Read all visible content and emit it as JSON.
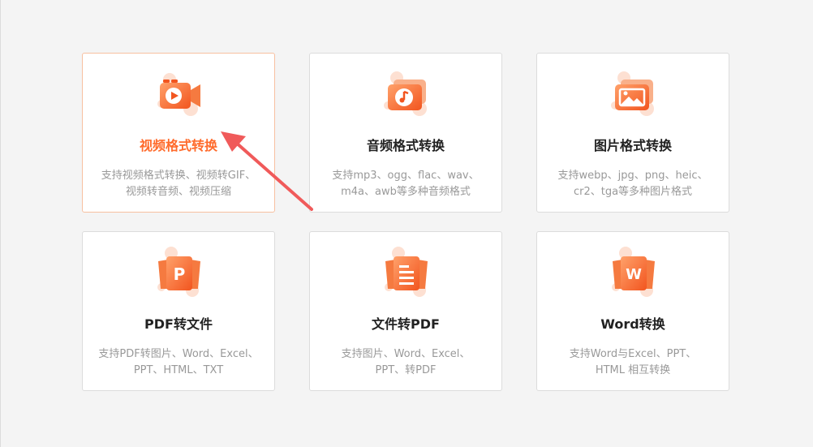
{
  "accent_color": "#ff6b2c",
  "annotation_color": "#f05a5a",
  "cards": [
    {
      "icon": "video-icon",
      "title": "视频格式转换",
      "desc_line1": "支持视频格式转换、视频转GIF、",
      "desc_line2": "视频转音频、视频压缩",
      "active": true
    },
    {
      "icon": "audio-icon",
      "title": "音频格式转换",
      "desc_line1": "支持mp3、ogg、flac、wav、",
      "desc_line2": "m4a、awb等多种音频格式",
      "active": false
    },
    {
      "icon": "image-icon",
      "title": "图片格式转换",
      "desc_line1": "支持webp、jpg、png、heic、",
      "desc_line2": "cr2、tga等多种图片格式",
      "active": false
    },
    {
      "icon": "pdf-icon",
      "title": "PDF转文件",
      "desc_line1": "支持PDF转图片、Word、Excel、",
      "desc_line2": "PPT、HTML、TXT",
      "active": false
    },
    {
      "icon": "document-icon",
      "title": "文件转PDF",
      "desc_line1": "支持图片、Word、Excel、",
      "desc_line2": "PPT、转PDF",
      "active": false
    },
    {
      "icon": "word-icon",
      "title": "Word转换",
      "desc_line1": "支持Word与Excel、PPT、",
      "desc_line2": "HTML 相互转换",
      "active": false
    }
  ]
}
